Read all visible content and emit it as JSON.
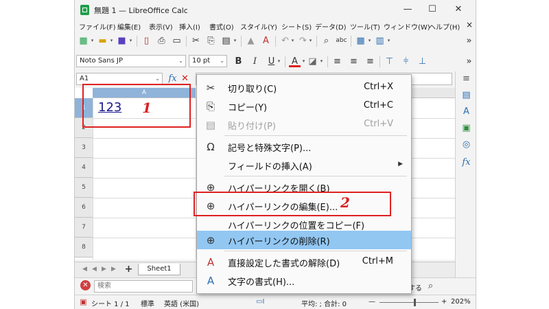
{
  "window": {
    "title": "無題 1 — LibreOffice Calc",
    "minimize": "—",
    "maximize": "☐",
    "close": "✕"
  },
  "menubar": [
    "ファイル(F)",
    "編集(E)",
    "表示(V)",
    "挿入(I)",
    "書式(O)",
    "スタイル(Y)",
    "シート(S)",
    "データ(D)",
    "ツール(T)",
    "ウィンドウ(W)",
    "ヘルプ(H)"
  ],
  "menubar_close": "×",
  "toolbar": {
    "font_name": "Noto Sans JP",
    "font_size": "10 pt",
    "bold": "B",
    "italic": "I",
    "underline": "U",
    "font_color_letter": "A",
    "overflow": "»",
    "font_color": "#e02020"
  },
  "formula_bar": {
    "name_box": "A1",
    "fx": "fx",
    "cancel": "✕"
  },
  "sheet": {
    "column_a": "A",
    "rows": [
      "1",
      "2",
      "3",
      "4",
      "5",
      "6",
      "7",
      "8"
    ],
    "cell_a1": "123"
  },
  "annotations": {
    "step1": "1",
    "step2": "2",
    "box_color": "#e02020"
  },
  "tabs": {
    "add": "+",
    "sheet1": "Sheet1"
  },
  "findbar": {
    "placeholder": "検索",
    "partial_text": "する"
  },
  "statusbar": {
    "sheet": "シート 1 / 1",
    "style": "標準",
    "language": "英語 (米国)",
    "sum": "平均: ; 合計: 0",
    "zoom_minus": "—",
    "zoom_plus": "+",
    "zoom": "202%"
  },
  "context_menu": [
    {
      "icon": "scissors-icon",
      "glyph": "✂",
      "label": "切り取り(C)",
      "shortcut": "Ctrl+X",
      "disabled": false
    },
    {
      "icon": "copy-icon",
      "glyph": "⎘",
      "label": "コピー(Y)",
      "shortcut": "Ctrl+C",
      "disabled": false
    },
    {
      "icon": "paste-icon",
      "glyph": "📋",
      "label": "貼り付け(P)",
      "shortcut": "Ctrl+V",
      "disabled": true
    },
    {
      "icon": "omega-icon",
      "glyph": "Ω",
      "label": "記号と特殊文字(P)...",
      "shortcut": "",
      "disabled": false
    },
    {
      "icon": "",
      "glyph": "",
      "label": "フィールドの挿入(A)",
      "shortcut": "",
      "disabled": false,
      "submenu": true
    },
    {
      "icon": "hyperlink-open-icon",
      "glyph": "🌐",
      "label": "ハイパーリンクを開く(B)",
      "shortcut": "",
      "disabled": false
    },
    {
      "icon": "hyperlink-edit-icon",
      "glyph": "🌐",
      "label": "ハイパーリンクの編集(E)...",
      "shortcut": "",
      "disabled": false
    },
    {
      "icon": "",
      "glyph": "",
      "label": "ハイパーリンクの位置をコピー(F)",
      "shortcut": "",
      "disabled": false
    },
    {
      "icon": "hyperlink-remove-icon",
      "glyph": "🌐",
      "label": "ハイパーリンクの削除(R)",
      "shortcut": "",
      "disabled": false,
      "highlighted": true
    },
    {
      "icon": "clear-format-icon",
      "glyph": "A",
      "label": "直接設定した書式の解除(D)",
      "shortcut": "Ctrl+M",
      "disabled": false
    },
    {
      "icon": "character-icon",
      "glyph": "A",
      "label": "文字の書式(H)...",
      "shortcut": "",
      "disabled": false
    }
  ]
}
